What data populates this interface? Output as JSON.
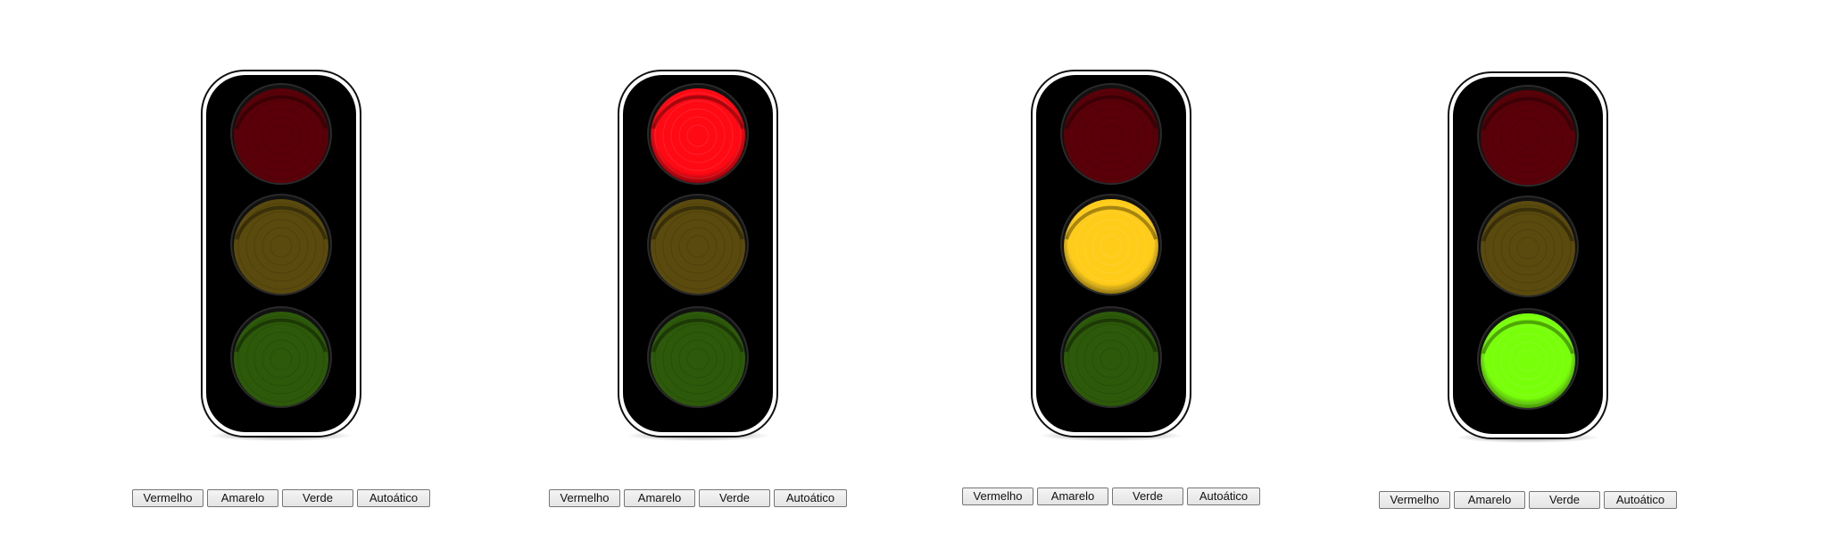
{
  "buttons": {
    "red": "Vermelho",
    "yellow": "Amarelo",
    "green": "Verde",
    "auto": "Autoático"
  },
  "colors": {
    "housing": "#000000",
    "red_on": "#ff0a14",
    "red_off": "#5a0008",
    "yellow_on": "#ffcc1a",
    "yellow_off": "#5a4a0e",
    "green_on": "#78ff0a",
    "green_off": "#2d5a0a"
  },
  "traffic_lights": [
    {
      "active": "none"
    },
    {
      "active": "red"
    },
    {
      "active": "yellow"
    },
    {
      "active": "green"
    }
  ]
}
